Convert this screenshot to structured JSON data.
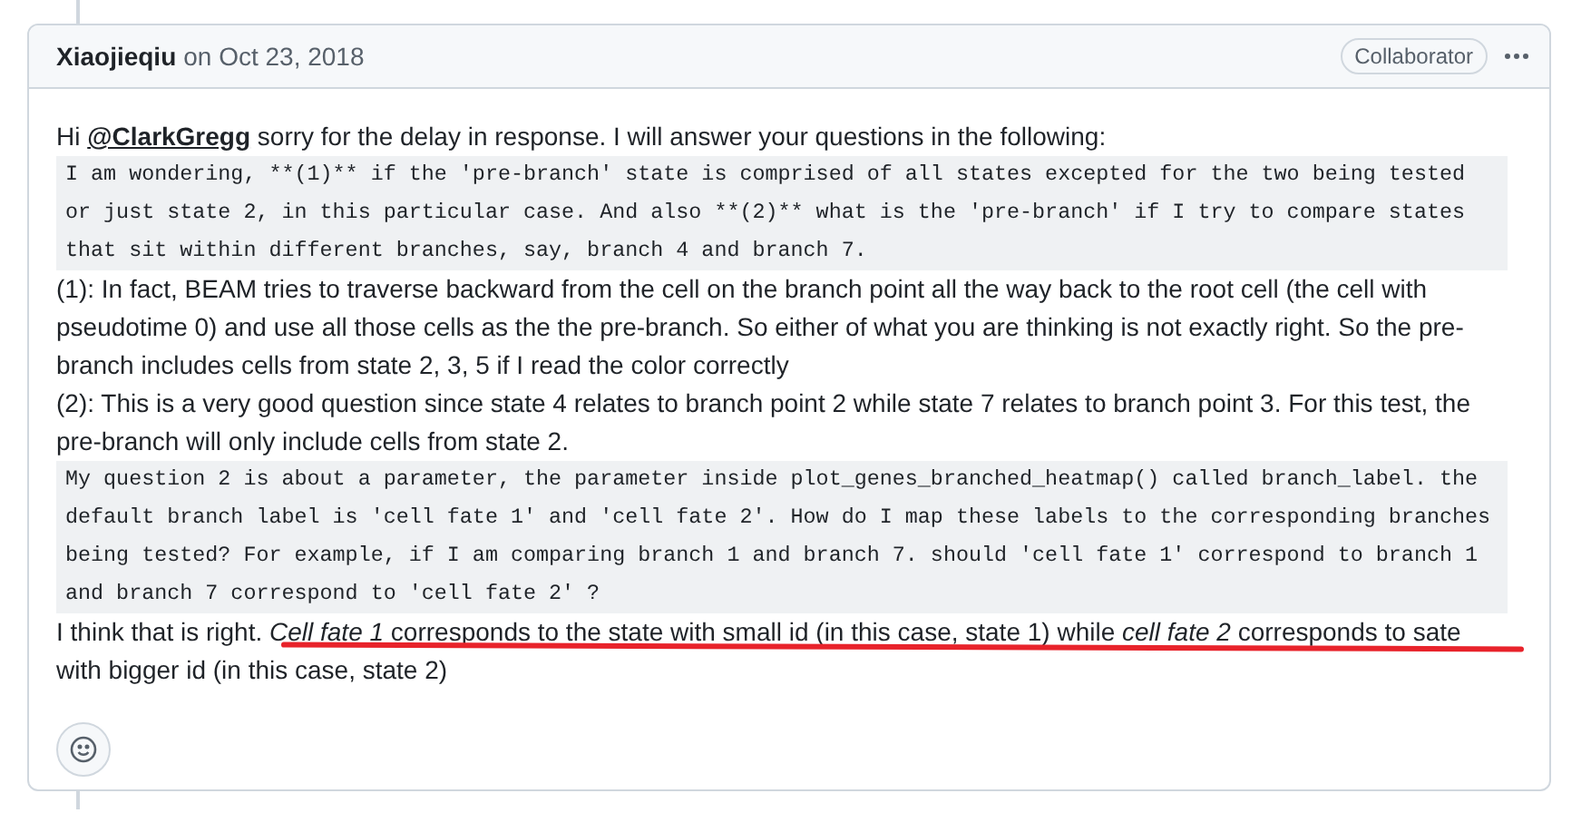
{
  "comment": {
    "author": "Xiaojieqiu",
    "date": "on Oct 23, 2018",
    "badge": "Collaborator",
    "blocks": [
      {
        "kind": "text",
        "before": "Hi ",
        "mention": "@ClarkGregg",
        "after": " sorry for the delay in response. I will answer your questions in the following:"
      },
      {
        "kind": "quote",
        "text": "I am wondering, **(1)** if the 'pre-branch' state is comprised of all states excepted for the two being tested or just state 2, in this particular case. And also **(2)** what is the 'pre-branch' if I try to compare states that sit within different branches, say, branch 4 and branch 7."
      },
      {
        "kind": "text",
        "text": "(1): In fact, BEAM tries to traverse backward from the cell on the branch point all the way back to the root cell (the cell with pseudotime 0) and use all those cells as the the pre-branch. So either of what you are thinking is not exactly right. So the pre-branch includes cells from state 2, 3, 5 if I read the color correctly"
      },
      {
        "kind": "text",
        "text": "(2): This is a very good question since state 4 relates to branch point 2 while state 7 relates to branch point 3. For this test, the pre-branch will only include cells from state 2."
      },
      {
        "kind": "quote",
        "text": "My question 2 is about a parameter, the parameter inside plot_genes_branched_heatmap() called branch_label. the default branch label is 'cell fate 1' and 'cell fate 2'. How do I map these labels to the corresponding branches being tested? For example, if I am comparing branch 1 and branch 7. should 'cell fate 1' correspond to branch 1 and branch 7 correspond to 'cell fate 2' ?"
      },
      {
        "kind": "text",
        "underlined": true,
        "text": "I think that is right. *Cell fate 1* corresponds to the state with small id (in this case, state 1) while *cell fate 2* corresponds to sate with bigger id (in this case, state 2)"
      }
    ]
  }
}
